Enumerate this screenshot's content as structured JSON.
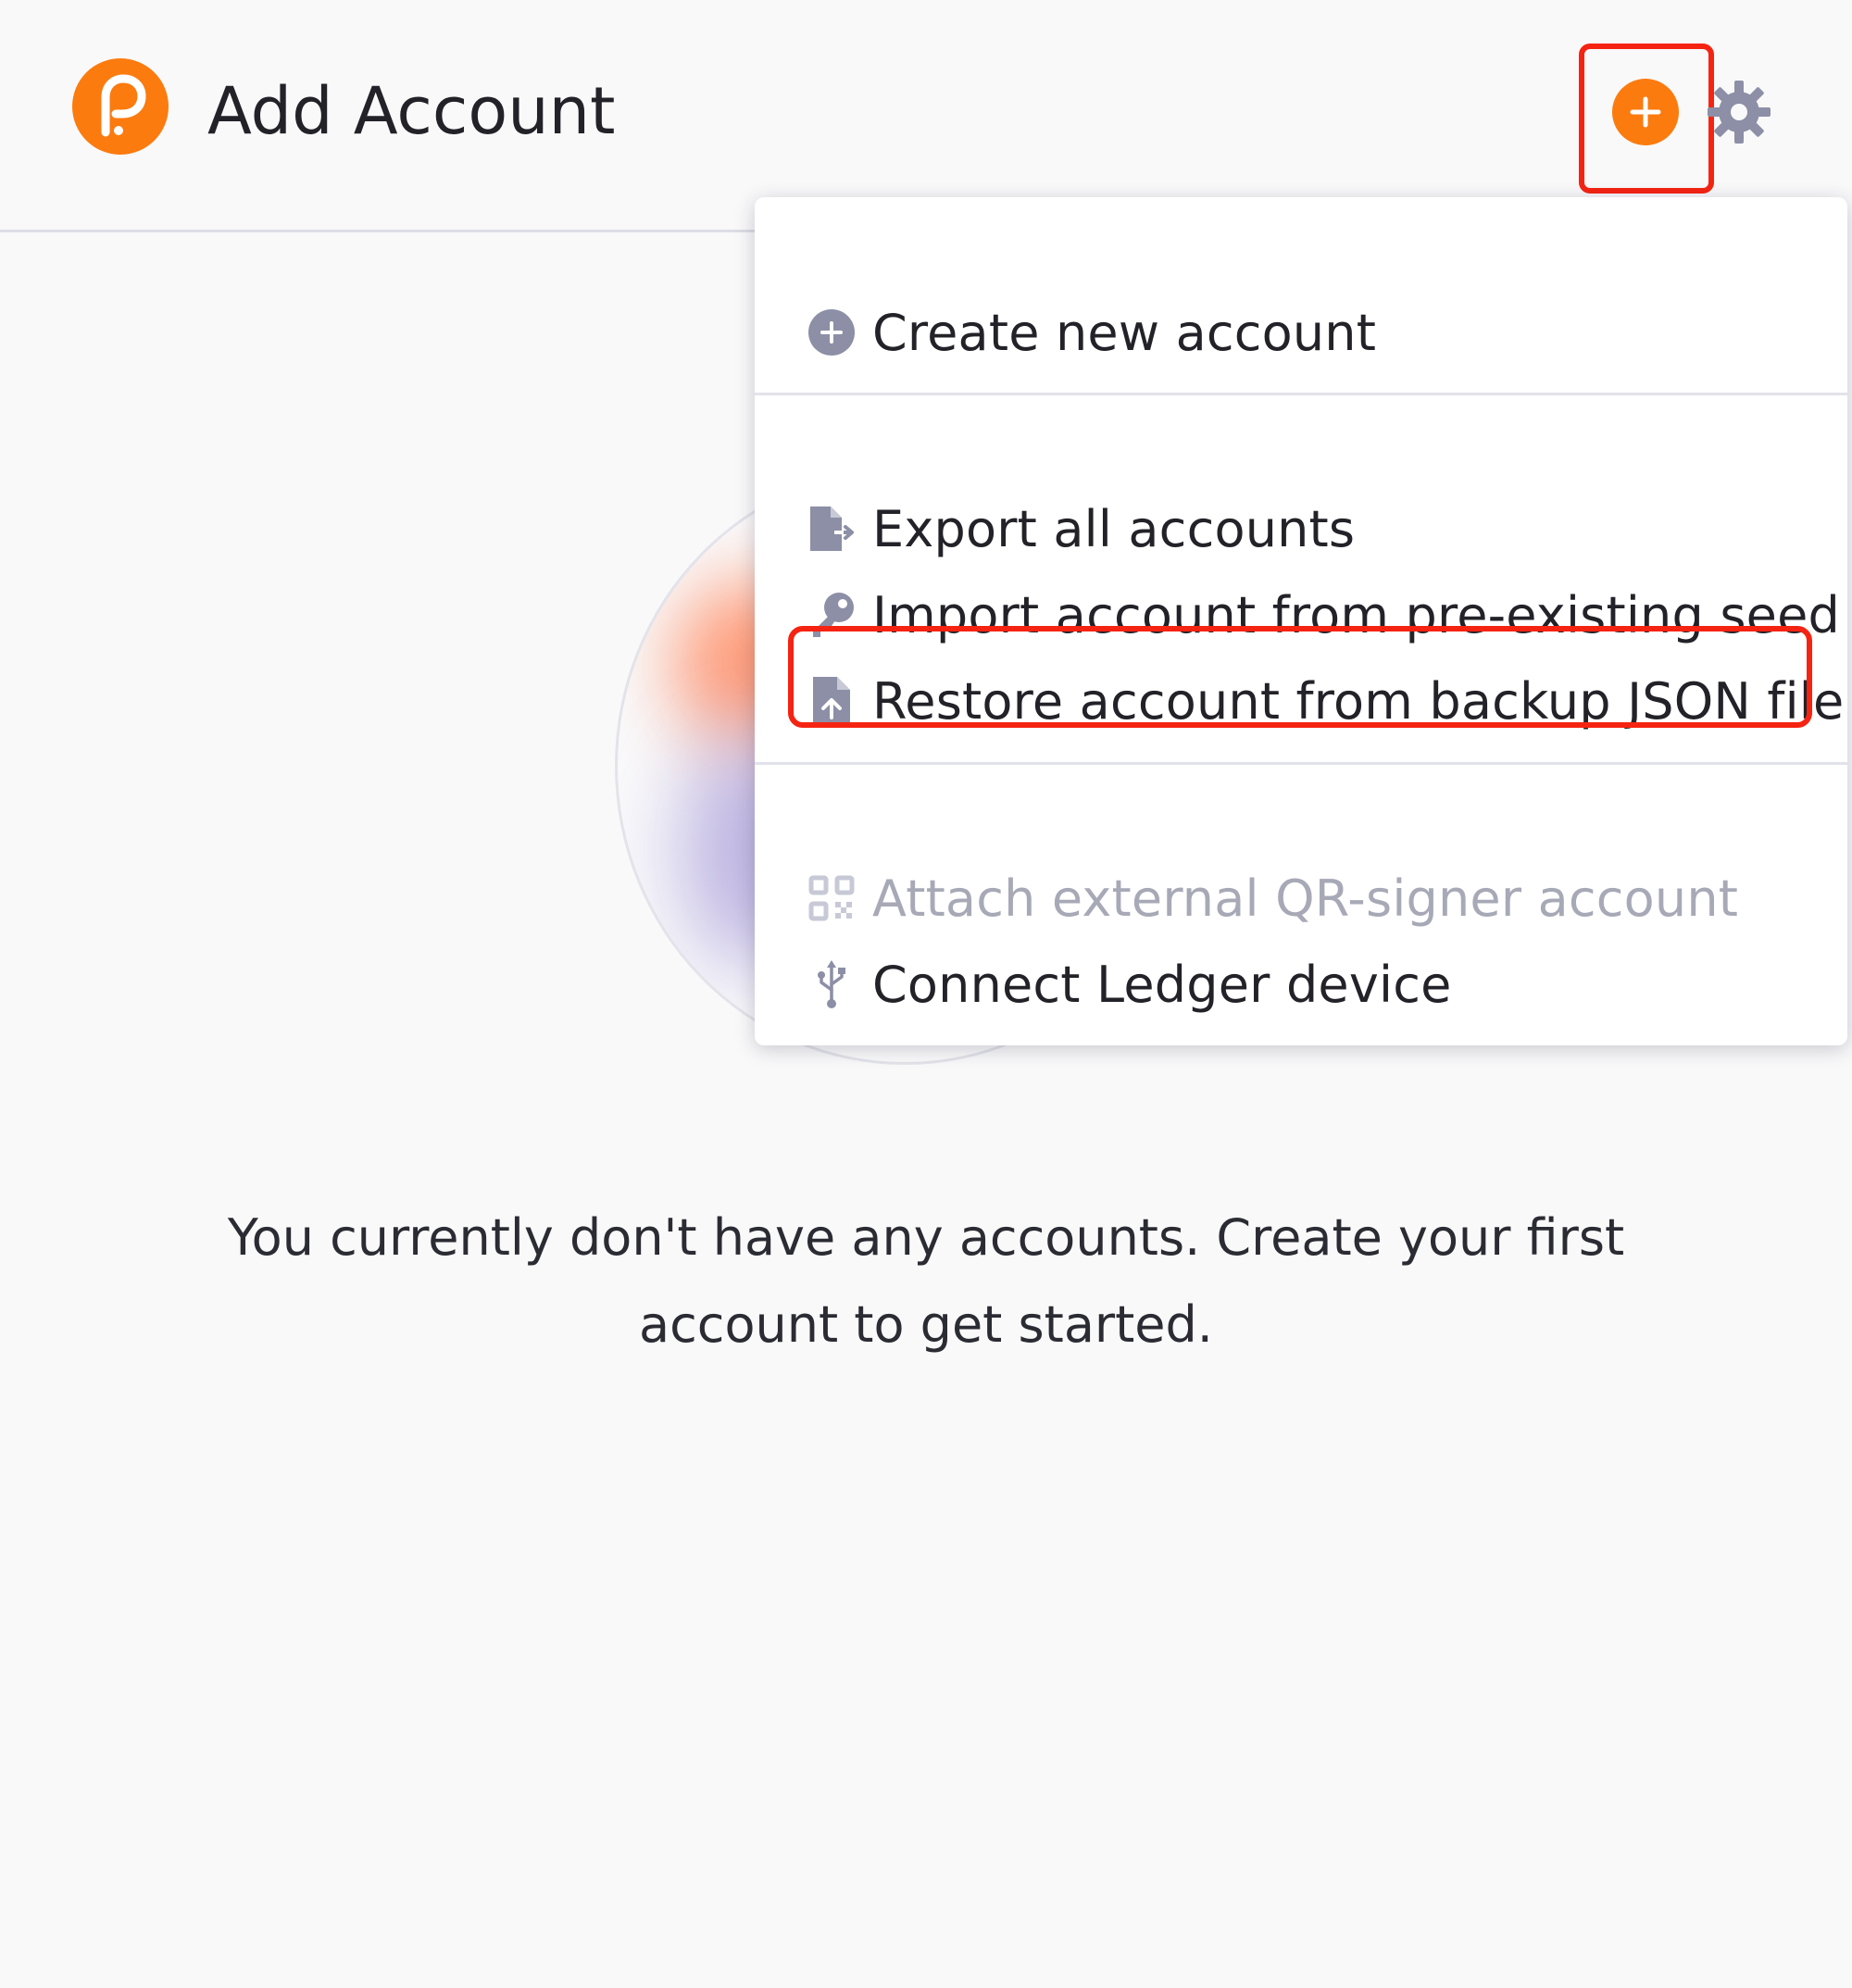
{
  "header": {
    "title": "Add Account",
    "logo_icon": "polkadot-logo-icon",
    "add_button_icon": "plus-circle-icon",
    "settings_button_icon": "gear-icon",
    "accent_color": "#fb7b0f",
    "icon_color": "#8c8fa6"
  },
  "menu": {
    "sections": [
      {
        "items": [
          {
            "label": "Create new account",
            "icon": "plus-circle-icon",
            "disabled": false
          }
        ]
      },
      {
        "items": [
          {
            "label": "Export all accounts",
            "icon": "file-export-icon",
            "disabled": false
          },
          {
            "label": "Import account from pre-existing seed",
            "icon": "key-icon",
            "disabled": false
          },
          {
            "label": "Restore account from backup JSON file",
            "icon": "file-upload-icon",
            "disabled": false,
            "highlighted": true
          }
        ]
      },
      {
        "items": [
          {
            "label": "Attach external QR-signer account",
            "icon": "qrcode-icon",
            "disabled": true
          },
          {
            "label": "Connect Ledger device",
            "icon": "usb-icon",
            "disabled": false
          }
        ]
      }
    ]
  },
  "empty_state": {
    "message": "You currently don't have any accounts. Create your first account to get started."
  },
  "annotation_color": "#f52412"
}
